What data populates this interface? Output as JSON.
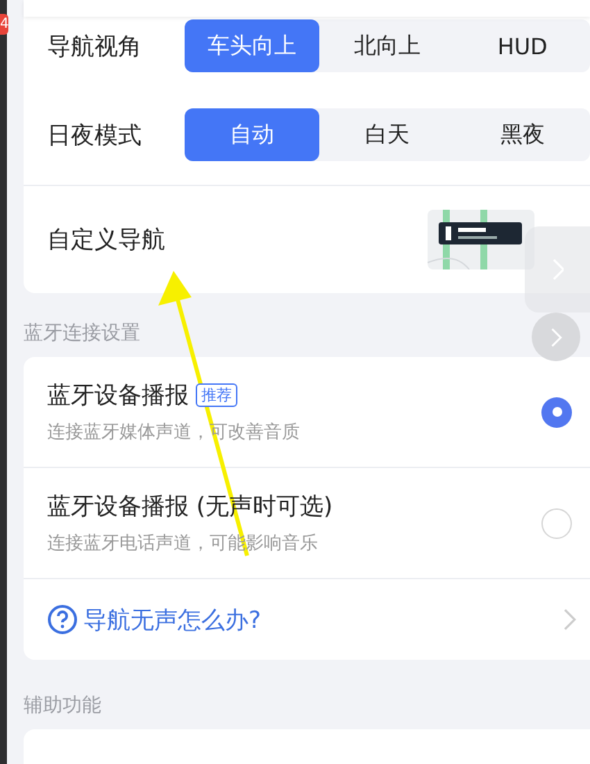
{
  "side_badge": "4",
  "settings": [
    {
      "kind": "segmented",
      "label": "导航视角",
      "options": [
        {
          "label": "车头向上",
          "selected": true
        },
        {
          "label": "北向上",
          "selected": false
        },
        {
          "label": "HUD",
          "selected": false
        }
      ]
    },
    {
      "kind": "segmented",
      "label": "日夜模式",
      "options": [
        {
          "label": "自动",
          "selected": true
        },
        {
          "label": "白天",
          "selected": false
        },
        {
          "label": "黑夜",
          "selected": false
        }
      ]
    },
    {
      "kind": "preview",
      "label": "自定义导航"
    }
  ],
  "bluetooth": {
    "title": "蓝牙连接设置",
    "options": [
      {
        "label": "蓝牙设备播报",
        "tag": "推荐",
        "description": "连接蓝牙媒体声道，可改善音质",
        "selected": true
      },
      {
        "label": "蓝牙设备播报 (无声时可选)",
        "description": "连接蓝牙电话声道，可能影响音乐",
        "selected": false
      }
    ],
    "help": "导航无声怎么办?"
  },
  "assist": {
    "title": "辅助功能"
  }
}
